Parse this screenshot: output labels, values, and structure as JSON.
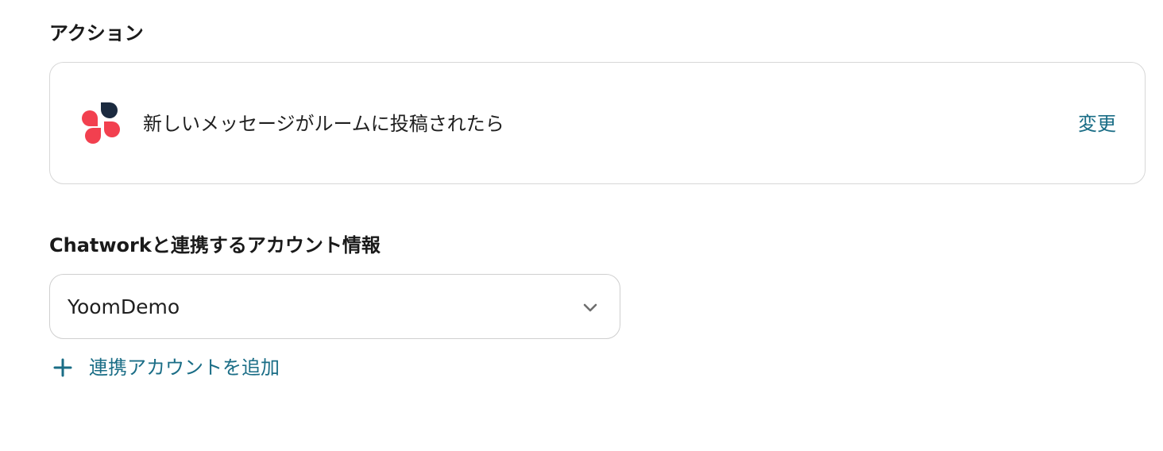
{
  "action_section": {
    "title": "アクション",
    "card": {
      "app_icon": "chatwork-logo-icon",
      "label": "新しいメッセージがルームに投稿されたら",
      "change_label": "変更"
    }
  },
  "account_section": {
    "title": "Chatworkと連携するアカウント情報",
    "selected_account": "YoomDemo",
    "add_account_label": "連携アカウントを追加"
  },
  "colors": {
    "accent": "#1a6d86",
    "chatwork_red": "#f2404f",
    "chatwork_navy": "#1b2a3f",
    "border": "#d7d7d7"
  }
}
